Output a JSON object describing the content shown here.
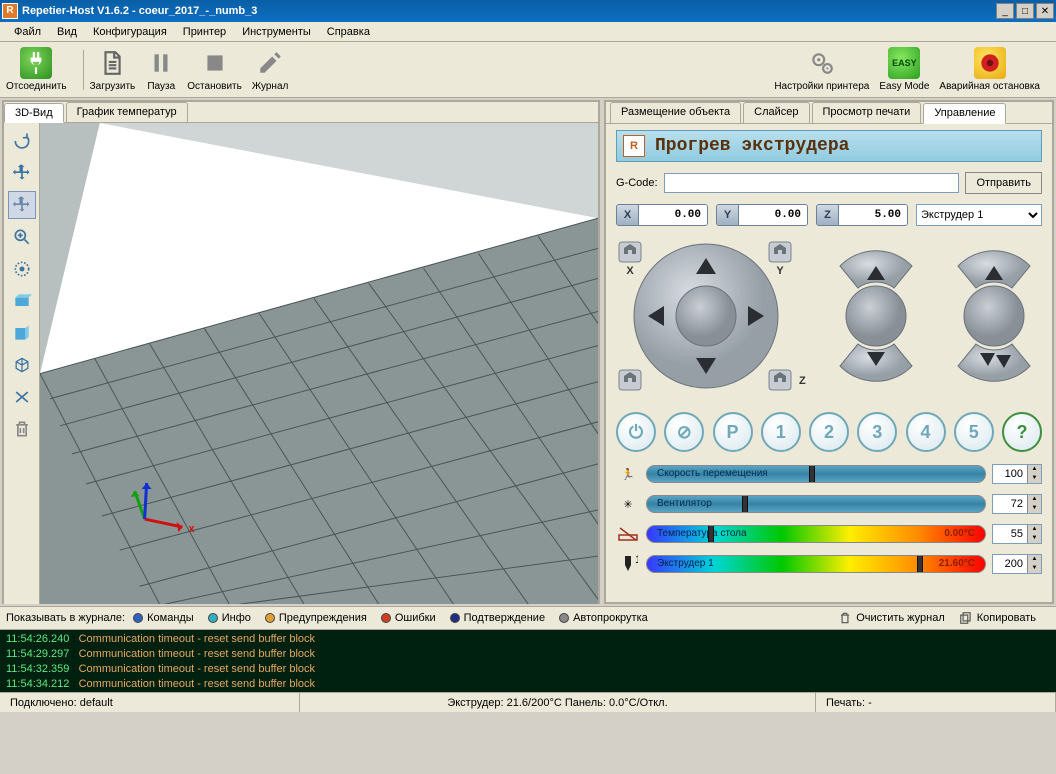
{
  "title": "Repetier-Host V1.6.2 - coeur_2017_-_numb_3",
  "menu": [
    "Файл",
    "Вид",
    "Конфигурация",
    "Принтер",
    "Инструменты",
    "Справка"
  ],
  "toolbar": {
    "disconnect": "Отсоединить",
    "load": "Загрузить",
    "pause": "Пауза",
    "stop": "Остановить",
    "log": "Журнал",
    "printer_settings": "Настройки принтера",
    "easy_mode": "Easy Mode",
    "emergency": "Аварийная остановка"
  },
  "left_tabs": {
    "view3d": "3D-Вид",
    "temp_graph": "График температур"
  },
  "right_tabs": {
    "placement": "Размещение объекта",
    "slicer": "Слайсер",
    "preview": "Просмотр печати",
    "control": "Управление"
  },
  "panel_header": "Прогрев экструдера",
  "gcode": {
    "label": "G-Code:",
    "value": "",
    "send": "Отправить"
  },
  "coords": {
    "x": {
      "axis": "X",
      "val": "0.00"
    },
    "y": {
      "axis": "Y",
      "val": "0.00"
    },
    "z": {
      "axis": "Z",
      "val": "5.00"
    },
    "extruder_sel": "Экструдер 1"
  },
  "dpad": {
    "x_home": "X",
    "y_home": "Y",
    "z_home": "Z"
  },
  "num_buttons": [
    "P",
    "1",
    "2",
    "3",
    "4",
    "5"
  ],
  "sliders": {
    "speed": {
      "label": "Скорость перемещения",
      "value": "100"
    },
    "fan": {
      "label": "Вентилятор",
      "value": "72"
    },
    "bed": {
      "label": "Температура стола",
      "overlay": "0.00°C",
      "value": "55"
    },
    "ext": {
      "label": "Экструдер 1",
      "overlay": "21.60°C",
      "value": "200"
    }
  },
  "log_toolbar": {
    "label": "Показывать в журнале:",
    "commands": "Команды",
    "info": "Инфо",
    "warn": "Предупреждения",
    "err": "Ошибки",
    "ack": "Подтверждение",
    "auto": "Автопрокрутка",
    "clear": "Очистить журнал",
    "copy": "Копировать"
  },
  "log_lines": [
    {
      "ts": "11:54:26.240",
      "msg": "Communication timeout - reset send buffer block"
    },
    {
      "ts": "11:54:29.297",
      "msg": "Communication timeout - reset send buffer block"
    },
    {
      "ts": "11:54:32.359",
      "msg": "Communication timeout - reset send buffer block"
    },
    {
      "ts": "11:54:34.212",
      "msg": "Communication timeout - reset send buffer block"
    }
  ],
  "status": {
    "conn": "Подключено: default",
    "extruder": "Экструдер: 21.6/200°C Панель: 0.0°C/Откл.",
    "print": "Печать: -"
  }
}
